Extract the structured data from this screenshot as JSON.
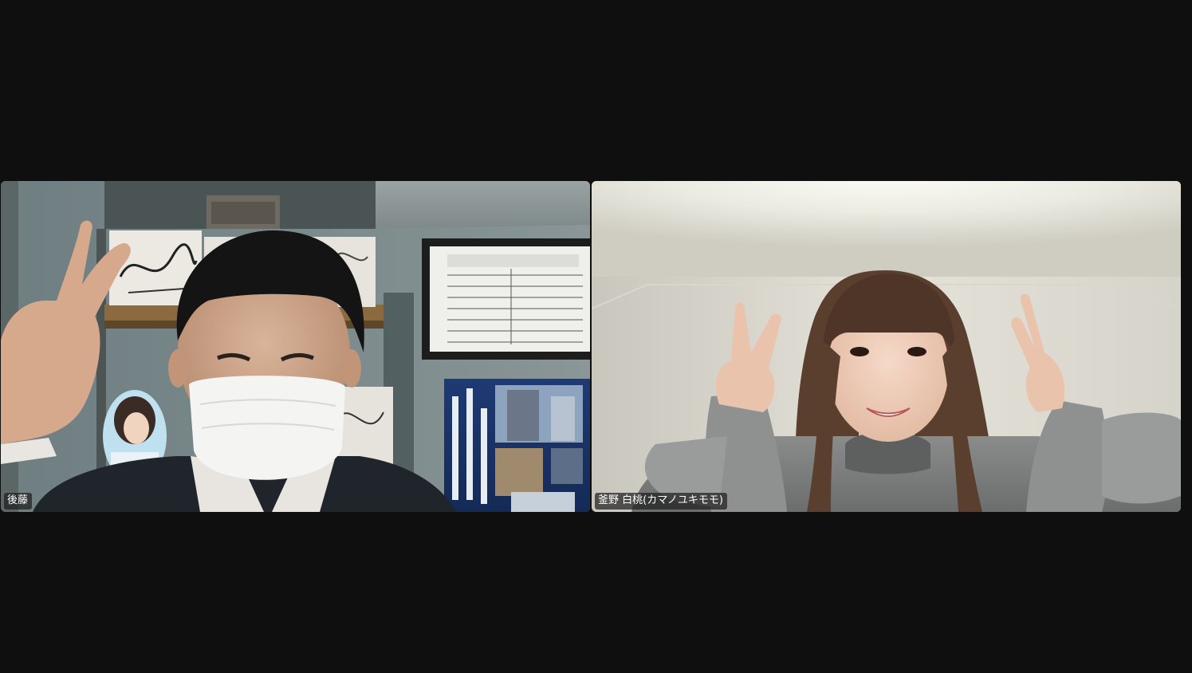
{
  "meeting": {
    "participants": [
      {
        "name": "後藤"
      },
      {
        "name": "釜野 白桃(カマノユキモモ)"
      }
    ]
  },
  "colors": {
    "background": "#0f0f0f",
    "name_tag_bg": "#1e1e1e",
    "name_tag_text": "#ffffff"
  }
}
